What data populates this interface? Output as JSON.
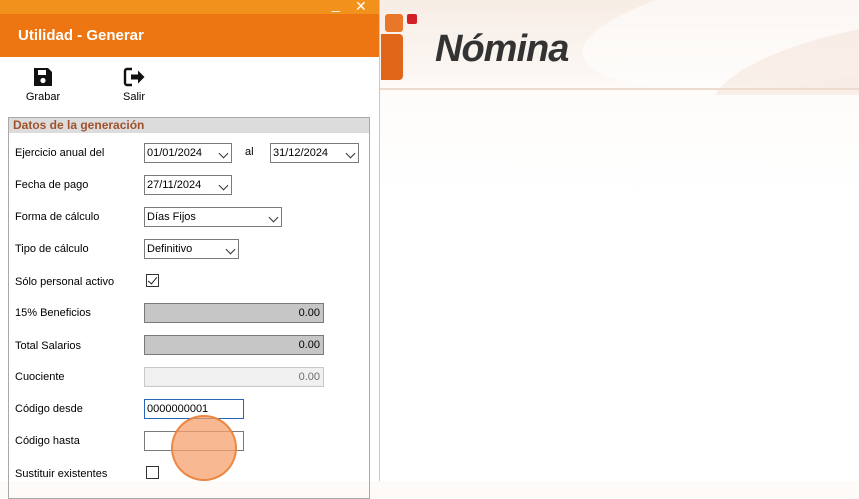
{
  "background": {
    "brand": "Nómina",
    "colors": {
      "logo_orange": "#e0661a",
      "logo_red": "#d1202a"
    }
  },
  "dialog": {
    "title": "Utilidad - Generar",
    "accent": "#ee7612",
    "window_buttons": {
      "minimize": "_",
      "close": "✕"
    },
    "toolbar": {
      "grabar": {
        "label": "Grabar",
        "icon": "save-icon"
      },
      "salir": {
        "label": "Salir",
        "icon": "exit-icon"
      }
    },
    "group_title": "Datos de la generación",
    "fields": {
      "ejercicio_label": "Ejercicio anual del",
      "ejercicio_desde": "01/01/2024",
      "ejercicio_al_label": "al",
      "ejercicio_hasta": "31/12/2024",
      "fecha_pago_label": "Fecha de pago",
      "fecha_pago": "27/11/2024",
      "forma_calculo_label": "Forma de cálculo",
      "forma_calculo": "Días Fijos",
      "tipo_calculo_label": "Tipo de cálculo",
      "tipo_calculo": "Definitivo",
      "solo_activo_label": "Sólo personal activo",
      "solo_activo": true,
      "beneficios_label": "15% Beneficios",
      "beneficios": "0.00",
      "total_salarios_label": "Total Salarios",
      "total_salarios": "0.00",
      "cociente_label": "Cuociente",
      "cociente": "0.00",
      "codigo_desde_label": "Código desde",
      "codigo_desde": "0000000001",
      "codigo_hasta_label": "Código hasta",
      "codigo_hasta": "",
      "sustituir_label": "Sustituir existentes",
      "sustituir": false
    }
  }
}
